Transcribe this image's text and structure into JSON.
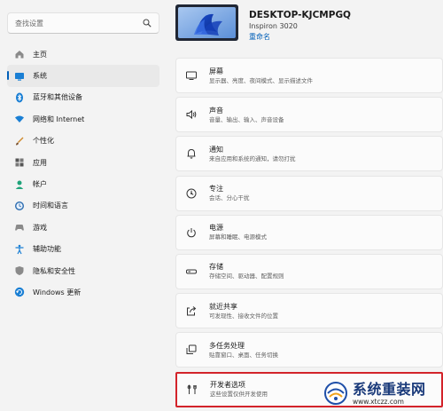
{
  "search": {
    "placeholder": "查找设置"
  },
  "sidebar": {
    "items": [
      {
        "label": "主页",
        "icon": "home-icon"
      },
      {
        "label": "系统",
        "icon": "system-icon",
        "active": true
      },
      {
        "label": "蓝牙和其他设备",
        "icon": "bluetooth-icon"
      },
      {
        "label": "网络和 Internet",
        "icon": "network-icon"
      },
      {
        "label": "个性化",
        "icon": "personalization-icon"
      },
      {
        "label": "应用",
        "icon": "apps-icon"
      },
      {
        "label": "帐户",
        "icon": "account-icon"
      },
      {
        "label": "时间和语言",
        "icon": "time-language-icon"
      },
      {
        "label": "游戏",
        "icon": "gaming-icon"
      },
      {
        "label": "辅助功能",
        "icon": "accessibility-icon"
      },
      {
        "label": "隐私和安全性",
        "icon": "privacy-icon"
      },
      {
        "label": "Windows 更新",
        "icon": "windows-update-icon"
      }
    ]
  },
  "device": {
    "name": "DESKTOP-KJCMPGQ",
    "model": "Inspiron 3020",
    "rename_label": "重命名"
  },
  "cards": [
    {
      "title": "屏幕",
      "subtitle": "显示器、亮度、夜间模式、显示描述文件",
      "icon": "display-icon"
    },
    {
      "title": "声音",
      "subtitle": "音量、输出、输入、声音设备",
      "icon": "sound-icon"
    },
    {
      "title": "通知",
      "subtitle": "来自应用和系统的通知，请勿打扰",
      "icon": "notifications-icon"
    },
    {
      "title": "专注",
      "subtitle": "会话、分心干扰",
      "icon": "focus-icon"
    },
    {
      "title": "电源",
      "subtitle": "屏幕和睡眠、电源模式",
      "icon": "power-icon"
    },
    {
      "title": "存储",
      "subtitle": "存储空间、驱动器、配置规则",
      "icon": "storage-icon"
    },
    {
      "title": "就近共享",
      "subtitle": "可发现性、接收文件的位置",
      "icon": "nearby-sharing-icon"
    },
    {
      "title": "多任务处理",
      "subtitle": "贴靠窗口、桌面、任务切换",
      "icon": "multitasking-icon"
    },
    {
      "title": "开发者选项",
      "subtitle": "这些设置仅供开发使用",
      "icon": "developer-icon",
      "highlighted": true
    }
  ],
  "watermark": {
    "title": "系统重装网",
    "url": "www.xtczz.com"
  },
  "colors": {
    "accent": "#005fb8",
    "highlight_border": "#d3232a",
    "background": "#f3f3f3",
    "card": "#fbfbfb"
  }
}
